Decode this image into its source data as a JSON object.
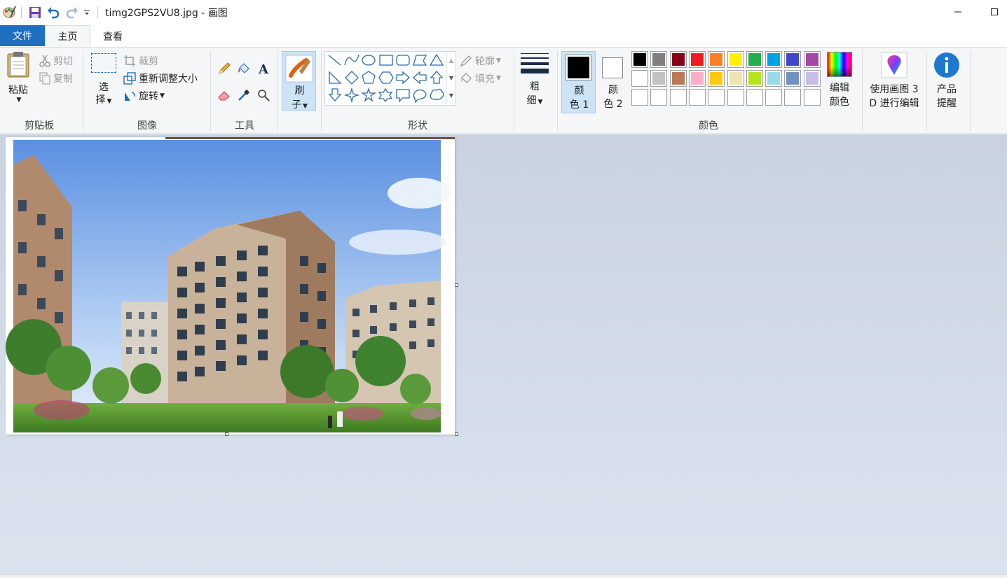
{
  "titlebar": {
    "title": "timg2GPS2VU8.jpg - 画图",
    "qat": [
      "paint-app-icon",
      "save-icon",
      "undo-icon",
      "redo-icon",
      "customize-dropdown-icon"
    ]
  },
  "tabs": {
    "file": "文件",
    "home": "主页",
    "view": "查看"
  },
  "clipboard": {
    "paste": "粘贴",
    "cut": "剪切",
    "copy": "复制",
    "group": "剪贴板"
  },
  "image": {
    "select_top": "选",
    "select_bottom": "择",
    "crop": "裁剪",
    "resize": "重新调整大小",
    "rotate": "旋转",
    "group": "图像"
  },
  "tools": {
    "group": "工具",
    "items": [
      "pencil-icon",
      "fill-bucket-icon",
      "text-icon",
      "eraser-icon",
      "color-picker-icon",
      "magnifier-icon"
    ]
  },
  "brushes": {
    "top": "刷",
    "bottom": "子"
  },
  "shapes": {
    "outline": "轮廓",
    "fill": "填充",
    "group": "形状"
  },
  "size": {
    "top": "粗",
    "bottom": "细"
  },
  "colors": {
    "color1_top": "颜",
    "color1_bottom": "色 1",
    "color2_top": "颜",
    "color2_bottom": "色 2",
    "edit_top": "编辑",
    "edit_bottom": "颜色",
    "group": "颜色",
    "color1_value": "#000000",
    "color2_value": "#ffffff",
    "palette_row1": [
      "#000000",
      "#7f7f7f",
      "#880015",
      "#ed1c24",
      "#ff7f27",
      "#fff200",
      "#22b14c",
      "#00a2e8",
      "#3f48cc",
      "#a349a4"
    ],
    "palette_row2": [
      "#ffffff",
      "#c3c3c3",
      "#b97a57",
      "#ffaec9",
      "#ffc90e",
      "#efe4b0",
      "#b5e61d",
      "#99d9ea",
      "#7092be",
      "#c8bfe7"
    ]
  },
  "paint3d": {
    "top": "使用画图 3",
    "bottom": "D 进行编辑"
  },
  "product": {
    "top": "产品",
    "bottom": "提醒"
  },
  "canvas": {
    "image_description_icon": "building-photo-image"
  }
}
